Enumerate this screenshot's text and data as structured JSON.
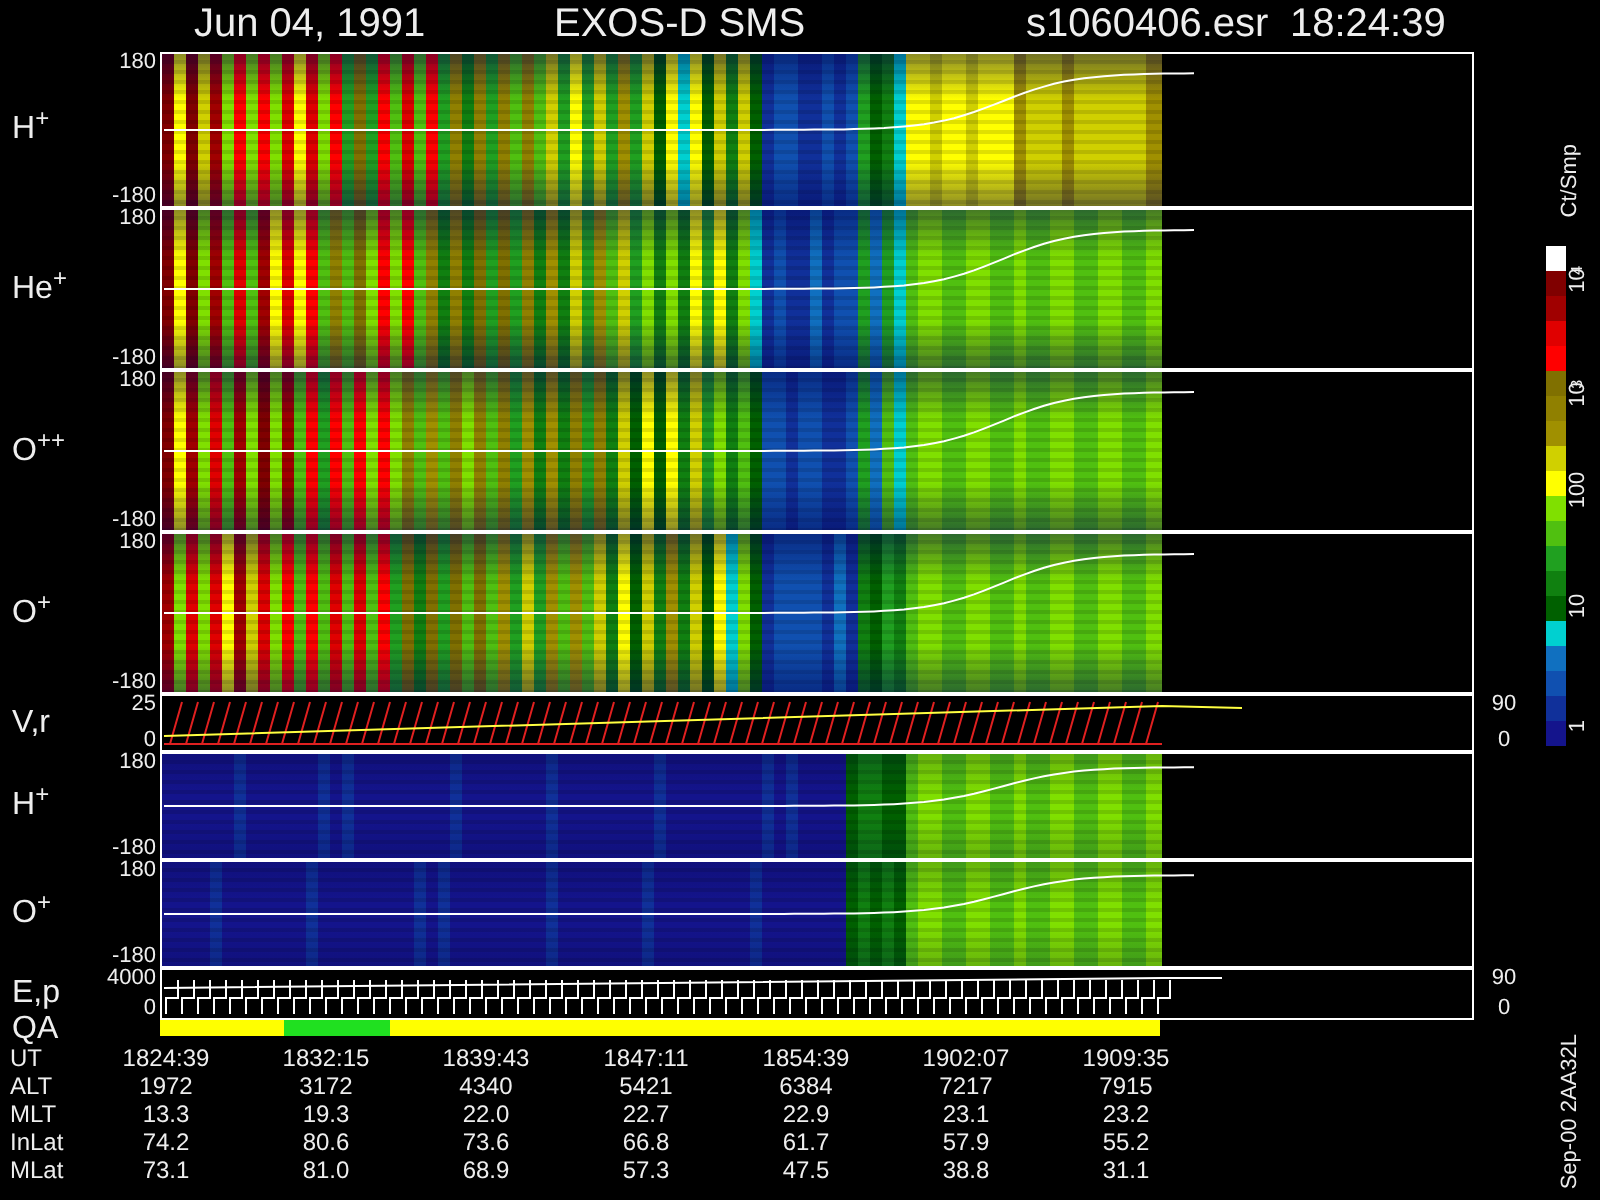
{
  "title": {
    "date": "Jun 04, 1991",
    "instrument": "EXOS-D SMS",
    "file": "s1060406.esr",
    "time": "18:24:39"
  },
  "panels": [
    {
      "kind": "spectrogram",
      "label": "H$^{+}$",
      "y_ticks": [
        "180",
        "-180"
      ]
    },
    {
      "kind": "spectrogram",
      "label": "He$^{+}$",
      "y_ticks": [
        "180",
        "-180"
      ]
    },
    {
      "kind": "spectrogram",
      "label": "O$^{++}$",
      "y_ticks": [
        "180",
        "-180"
      ]
    },
    {
      "kind": "spectrogram",
      "label": "O$^{+}$",
      "y_ticks": [
        "180",
        "-180"
      ]
    },
    {
      "kind": "velocity",
      "label": "V,r",
      "y_ticks": [
        "25",
        "0"
      ],
      "right_ticks": [
        "90",
        "0"
      ]
    },
    {
      "kind": "quiet_spectrogram",
      "label": "H$^{+}$",
      "y_ticks": [
        "180",
        "-180"
      ]
    },
    {
      "kind": "quiet_spectrogram",
      "label": "O$^{+}$",
      "y_ticks": [
        "180",
        "-180"
      ]
    },
    {
      "kind": "energy",
      "label": "E,p",
      "y_ticks": [
        "4000",
        "0"
      ],
      "right_ticks": [
        "90",
        "0"
      ]
    },
    {
      "kind": "quality",
      "label": "QA"
    }
  ],
  "colorbar": {
    "unit": "Ct/Smp",
    "labels": [
      "10$^{4}$",
      "10$^{3}$",
      "100",
      "10",
      "1"
    ]
  },
  "ephemeris": [
    {
      "label": "UT",
      "values": [
        "1824:39",
        "1832:15",
        "1839:43",
        "1847:11",
        "1854:39",
        "1902:07",
        "1909:35"
      ]
    },
    {
      "label": "ALT",
      "values": [
        "1972",
        "3172",
        "4340",
        "5421",
        "6384",
        "7217",
        "7915"
      ]
    },
    {
      "label": "MLT",
      "values": [
        "13.3",
        "19.3",
        "22.0",
        "22.7",
        "22.9",
        "23.1",
        "23.2"
      ]
    },
    {
      "label": "InLat",
      "values": [
        "74.2",
        "80.6",
        "73.6",
        "66.8",
        "61.7",
        "57.9",
        "55.2"
      ]
    },
    {
      "label": "MLat",
      "values": [
        "73.1",
        "81.0",
        "68.9",
        "57.3",
        "47.5",
        "38.8",
        "31.1"
      ]
    }
  ],
  "footer": "Sep-00 2AA32L"
}
